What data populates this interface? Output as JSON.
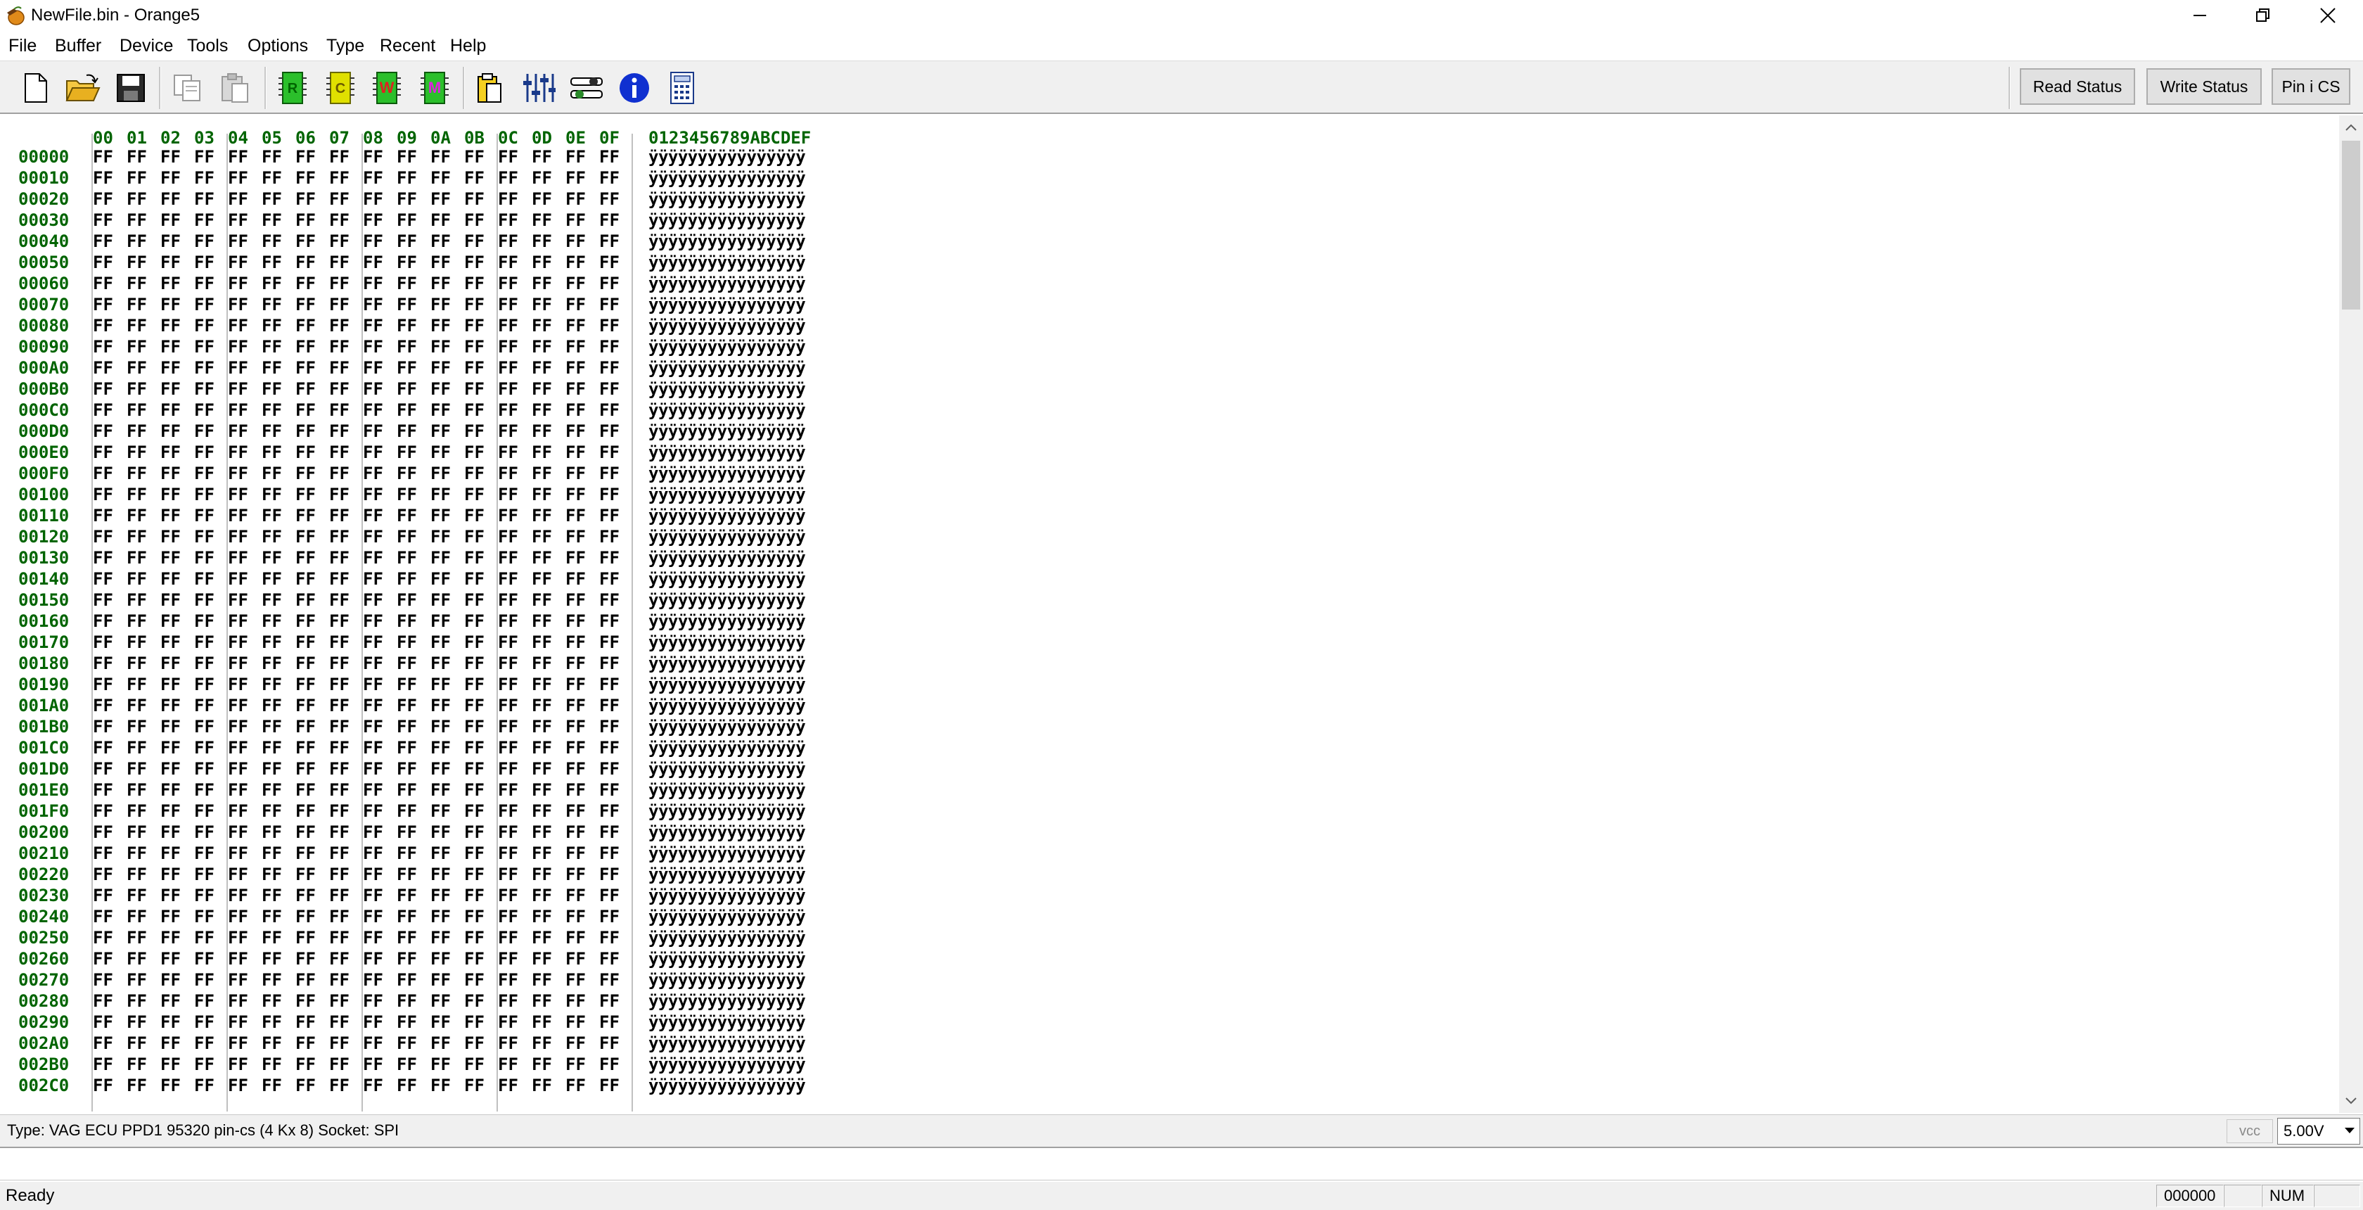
{
  "window": {
    "title": "NewFile.bin - Orange5"
  },
  "menu": {
    "items": [
      "File",
      "Buffer",
      "Device",
      "Tools",
      "Options",
      "Type",
      "Recent",
      "Help"
    ]
  },
  "toolbar": {
    "read_status_label": "Read Status",
    "write_status_label": "Write Status",
    "pin_cs_label": "Pin i CS",
    "read_device_label": "R",
    "compare_label": "C",
    "write_device_label": "W",
    "verify_label": "M",
    "colors": {
      "read": "#2bbf2b",
      "compare": "#e0e000",
      "write": "#e02020",
      "verify": "#e020e0",
      "info": "#1030d0"
    }
  },
  "hex": {
    "column_headers": [
      "00",
      "01",
      "02",
      "03",
      "04",
      "05",
      "06",
      "07",
      "08",
      "09",
      "0A",
      "0B",
      "0C",
      "0D",
      "0E",
      "0F"
    ],
    "ascii_header": "0123456789ABCDEF",
    "addresses": [
      "00000",
      "00010",
      "00020",
      "00030",
      "00040",
      "00050",
      "00060",
      "00070",
      "00080",
      "00090",
      "000A0",
      "000B0",
      "000C0",
      "000D0",
      "000E0",
      "000F0",
      "00100",
      "00110",
      "00120",
      "00130",
      "00140",
      "00150",
      "00160",
      "00170",
      "00180",
      "00190",
      "001A0",
      "001B0",
      "001C0",
      "001D0",
      "001E0",
      "001F0",
      "00200",
      "00210",
      "00220",
      "00230",
      "00240",
      "00250",
      "00260",
      "00270",
      "00280",
      "00290",
      "002A0",
      "002B0",
      "002C0"
    ],
    "byte_value": "FF",
    "ascii_value": "ÿÿÿÿÿÿÿÿÿÿÿÿÿÿÿÿ",
    "address_color": "#006400"
  },
  "typebar": {
    "type_info": "Type: VAG ECU PPD1  95320 pin-cs (4 Kx 8)   Socket: SPI",
    "vcc_label": "vcc",
    "vcc_value": "5.00V"
  },
  "command": {
    "value": ""
  },
  "status": {
    "text": "Ready",
    "address": "000000",
    "num": "NUM"
  }
}
